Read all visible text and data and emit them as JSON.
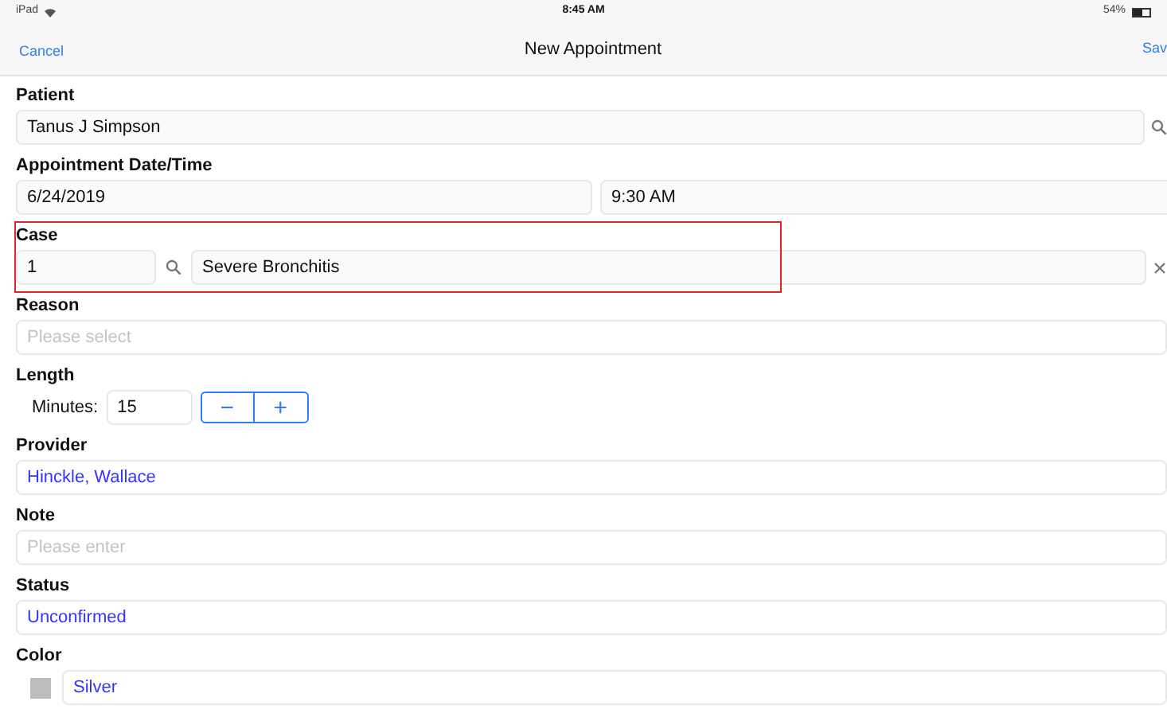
{
  "status_bar": {
    "device": "iPad",
    "time": "8:45 AM",
    "battery": "54%"
  },
  "nav": {
    "cancel": "Cancel",
    "title": "New Appointment",
    "save": "Sav"
  },
  "sections": [
    {
      "kind": "search",
      "label": "Patient",
      "value": "Tanus J Simpson"
    },
    {
      "kind": "datetime",
      "label": "Appointment Date/Time",
      "date": "6/24/2019",
      "time": "9:30 AM"
    },
    {
      "kind": "case",
      "label": "Case",
      "number": "1",
      "value": "Severe Bronchitis",
      "highlighted": true
    },
    {
      "kind": "picker",
      "label": "Reason",
      "placeholder": "Please select"
    },
    {
      "kind": "stepper",
      "label": "Length",
      "unit_label": "Minutes:",
      "value": "15",
      "minus": "−",
      "plus": "+"
    },
    {
      "kind": "picker",
      "label": "Provider",
      "value": "Hinckle, Wallace"
    },
    {
      "kind": "text",
      "label": "Note",
      "placeholder": "Please enter"
    },
    {
      "kind": "picker",
      "label": "Status",
      "value": "Unconfirmed"
    },
    {
      "kind": "color",
      "label": "Color",
      "value": "Silver",
      "color": "#bdbdbd"
    }
  ]
}
